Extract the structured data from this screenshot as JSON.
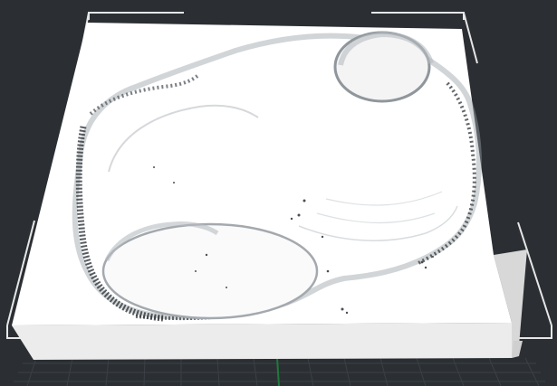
{
  "viewport": {
    "scene": "3d-print-preview"
  },
  "colors": {
    "background": "#2b2f33",
    "grid_line": "#3a4046",
    "grid_axis": "#1f7a3a",
    "bounding_box": "#e6e6e6",
    "model_top": "#ffffff",
    "model_front": "#eeeeee",
    "model_side": "#d5d5d5",
    "ridge_dark": "#3b4045",
    "ridge_mid": "#8f969c"
  },
  "icons": {
    "bounding-box": "bounding-box-icon"
  }
}
